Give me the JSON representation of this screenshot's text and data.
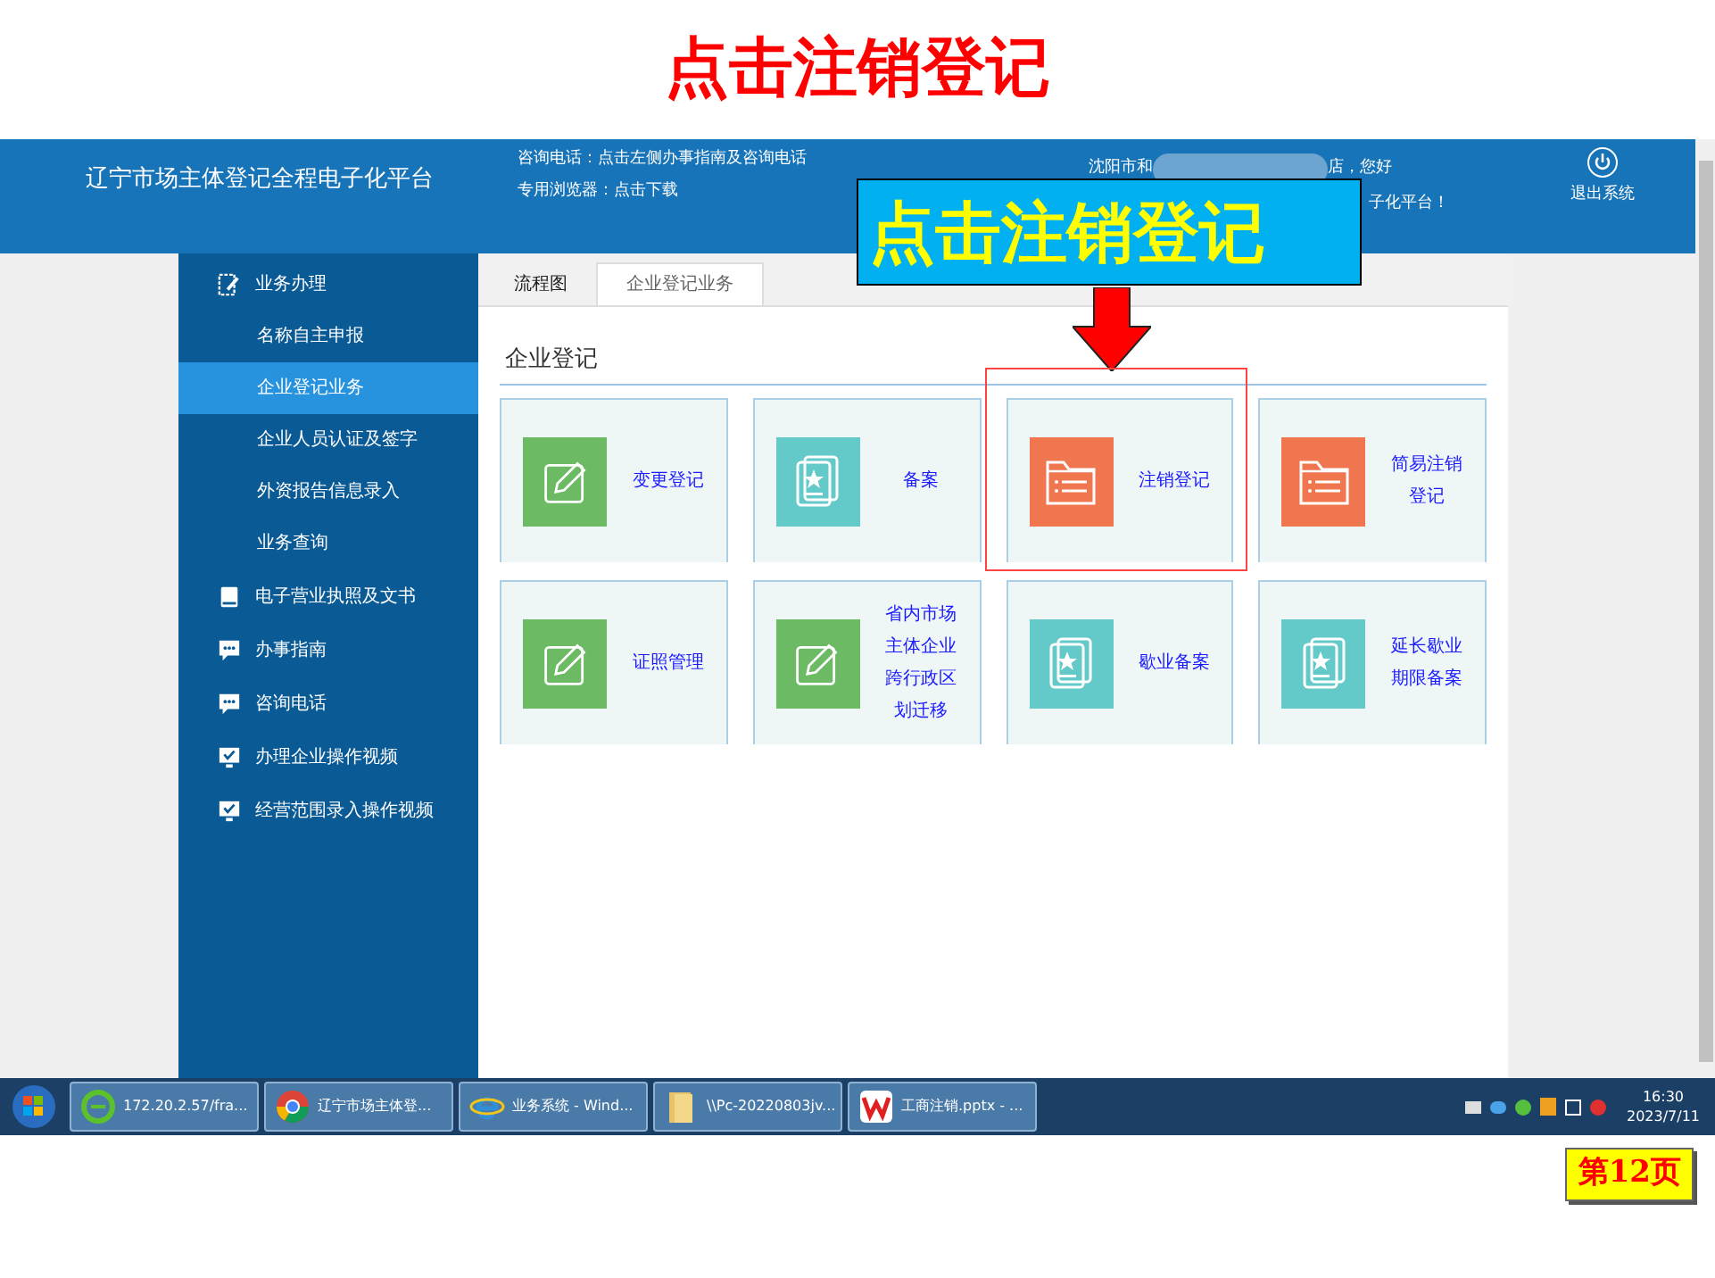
{
  "slide_title": "点击注销登记",
  "header": {
    "platform_name": "辽宁市场主体登记全程电子化平台",
    "hotline": "咨询电话：点击左侧办事指南及咨询电话",
    "browser": "专用浏览器：点击下载",
    "greeting_start": "沈阳市和",
    "greeting_end": "店，您好",
    "greeting_line_2": "子化平台！",
    "logout": "退出系统"
  },
  "sidebar": {
    "items": [
      {
        "label": "业务办理",
        "kind": "edit",
        "children": [
          {
            "label": "名称自主申报",
            "selected": false
          },
          {
            "label": "企业登记业务",
            "selected": true
          },
          {
            "label": "企业人员认证及签字",
            "selected": false
          },
          {
            "label": "外资报告信息录入",
            "selected": false
          },
          {
            "label": "业务查询",
            "selected": false
          }
        ]
      },
      {
        "label": "电子营业执照及文书",
        "kind": "book"
      },
      {
        "label": "办事指南",
        "kind": "chat"
      },
      {
        "label": "咨询电话",
        "kind": "chat"
      },
      {
        "label": "办理企业操作视频",
        "kind": "monitor"
      },
      {
        "label": "经营范围录入操作视频",
        "kind": "monitor"
      }
    ]
  },
  "tabs": [
    {
      "label": "流程图",
      "selected": false
    },
    {
      "label": "企业登记业务",
      "selected": true
    }
  ],
  "section_title": "企业登记",
  "tiles": [
    {
      "label": "变更登记",
      "kind": "edit",
      "color": "#6cbb64"
    },
    {
      "label": "备案",
      "kind": "star",
      "color": "#63c9c9"
    },
    {
      "label": "注销登记",
      "kind": "folder",
      "color": "#ef764e"
    },
    {
      "label": "简易注销登记",
      "kind": "folder",
      "color": "#ef764e"
    },
    {
      "label": "证照管理",
      "kind": "edit",
      "color": "#6cbb64"
    },
    {
      "label": "省内市场主体企业跨行政区划迁移",
      "kind": "edit",
      "color": "#6cbb64"
    },
    {
      "label": "歇业备案",
      "kind": "star",
      "color": "#63c9c9"
    },
    {
      "label": "延长歇业期限备案",
      "kind": "star",
      "color": "#63c9c9"
    }
  ],
  "callout": "点击注销登记",
  "taskbar": {
    "items": [
      {
        "label": "172.20.2.57/fra...",
        "kind": "ie-green"
      },
      {
        "label": "辽宁市场主体登...",
        "kind": "chrome"
      },
      {
        "label": "业务系统 - Wind...",
        "kind": "ie"
      },
      {
        "label": "\\\\Pc-20220803jv...",
        "kind": "folder"
      },
      {
        "label": "工商注销.pptx - ...",
        "kind": "wps"
      }
    ],
    "time": "16:30",
    "date": "2023/7/11"
  },
  "page_label": "第12页"
}
